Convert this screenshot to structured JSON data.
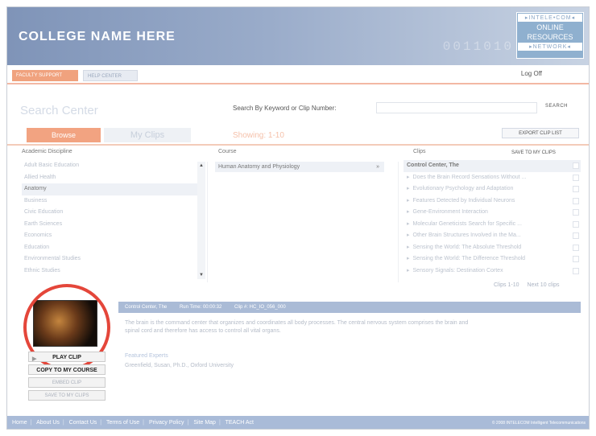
{
  "header": {
    "college": "COLLEGE NAME HERE",
    "brand_top": "▸INTELE•COM◂",
    "brand_mid1": "ONLINE",
    "brand_mid2": "RESOURCES",
    "brand_bottom": "▸NETWORK◂",
    "bg_digits": "0011010"
  },
  "nav": {
    "active_tab": "FACULTY SUPPORT",
    "help_tab": "HELP CENTER",
    "logoff": "Log Off"
  },
  "search": {
    "title": "Search Center",
    "label": "Search By Keyword or Clip Number:",
    "input_value": "",
    "button": "SEARCH"
  },
  "tabs": {
    "browse": "Browse",
    "myclips": "My Clips",
    "showing": "Showing: 1-10"
  },
  "export_label": "EXPORT CLIP LIST",
  "columns": {
    "discipline_header": "Academic Discipline",
    "course_header": "Course",
    "clips_header": "Clips",
    "save_label": "SAVE TO MY CLIPS"
  },
  "disciplines": [
    "Adult Basic Education",
    "Allied Health",
    "Anatomy",
    "Business",
    "Civic Education",
    "Earth Sciences",
    "Economics",
    "Education",
    "Environmental Studies",
    "Ethnic Studies"
  ],
  "courses": {
    "selected": "Human Anatomy and Physiology",
    "arrow": "»"
  },
  "clips": [
    "Control Center, The",
    "Does the Brain Record Sensations Without ...",
    "Evolutionary Psychology and Adaptation",
    "Features Detected by Individual Neurons",
    "Gene-Environment Interaction",
    "Molecular Geneticists Search for Specific ...",
    "Other Brain Structures Involved in the Ma...",
    "Sensing the World: The Absolute Threshold",
    "Sensing the World: The Difference Threshold",
    "Sensory Signals: Destination Cortex"
  ],
  "pager": {
    "range": "Clips 1-10",
    "next": "Next 10 clips"
  },
  "detail": {
    "title": "Control Center, The",
    "runtime": "Run Time: 00:00:32",
    "clip_no": "Clip #: HC_IO_056_000",
    "description": "The brain is the command center that organizes and coordinates all body processes. The central nervous system comprises the brain and spinal cord and therefore has access to control all vital organs.",
    "experts_label": "Featured Experts",
    "expert_name": "Greenfield, Susan, Ph.D., Oxford University"
  },
  "actions": {
    "play": "PLAY CLIP",
    "copy": "COPY TO MY COURSE",
    "embed": "EMBED CLIP",
    "save": "SAVE TO MY CLIPS"
  },
  "footer": {
    "links": [
      "Home",
      "About Us",
      "Contact Us",
      "Terms of Use",
      "Privacy Policy",
      "Site Map",
      "TEACH Act"
    ],
    "copyright": "© 2008 INTELECOM Intelligent Telecommunications"
  },
  "colors": {
    "accent": "#f2a381",
    "header_blue": "#8fa3c4",
    "highlight": "#e4463a"
  }
}
